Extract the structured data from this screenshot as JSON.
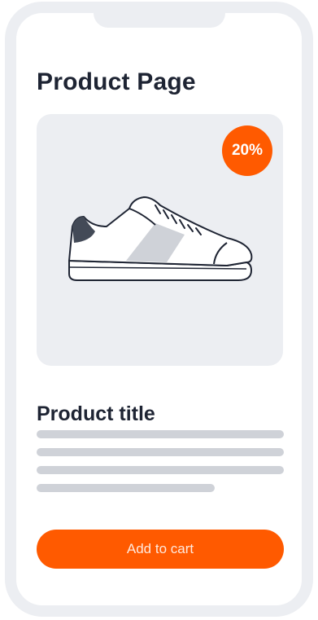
{
  "page": {
    "title": "Product Page"
  },
  "product": {
    "discount_badge": "20%",
    "title": "Product title",
    "image_icon": "sneaker-illustration",
    "description_placeholder_lines": 4
  },
  "actions": {
    "add_to_cart_label": "Add to cart"
  },
  "colors": {
    "accent": "#ff5a00",
    "text_dark": "#1e2433",
    "frame": "#eceef2",
    "placeholder": "#cfd2d8"
  }
}
